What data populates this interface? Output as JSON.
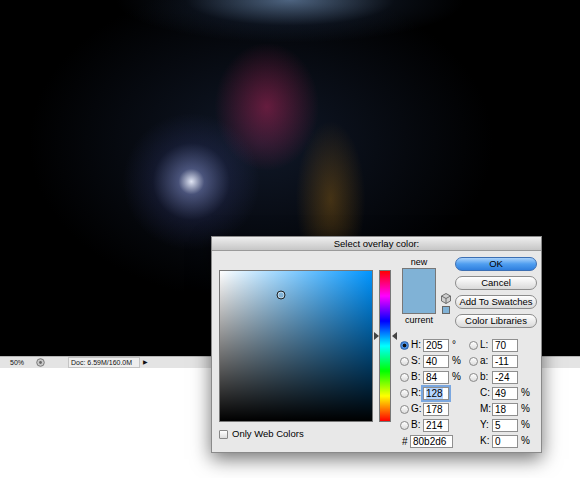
{
  "document": {
    "zoom": "50%",
    "info": "Doc: 6.59M/160.0M",
    "menu_arrow": "▶"
  },
  "dialog": {
    "title": "Select overlay color:",
    "color_field": {
      "hue_color": "#0095ff",
      "x_level": 0.4,
      "y_level": 0.84
    },
    "hue_slider": {
      "level": 0.57
    },
    "swatch": {
      "new_label": "new",
      "current_label": "current",
      "new_color": "#80b2d6",
      "current_color": "#80b2d6"
    },
    "buttons": [
      {
        "label": "OK",
        "default": true
      },
      {
        "label": "Cancel",
        "default": false
      },
      {
        "label": "Add To Swatches",
        "default": false
      },
      {
        "label": "Color Libraries",
        "default": false
      }
    ],
    "fields_left": [
      {
        "label": "H:",
        "value": "205",
        "unit": "°",
        "selected": true,
        "focused": false
      },
      {
        "label": "S:",
        "value": "40",
        "unit": "%",
        "selected": false,
        "focused": false
      },
      {
        "label": "B:",
        "value": "84",
        "unit": "%",
        "selected": false,
        "focused": false
      },
      {
        "label": "R:",
        "value": "128",
        "selected": false,
        "focused": true
      },
      {
        "label": "G:",
        "value": "178",
        "selected": false,
        "focused": false
      },
      {
        "label": "B:",
        "value": "214",
        "selected": false,
        "focused": false
      }
    ],
    "fields_lab": [
      {
        "label": "L:",
        "value": "70",
        "selected": false,
        "focused": false
      },
      {
        "label": "a:",
        "value": "-11",
        "selected": false,
        "focused": false
      },
      {
        "label": "b:",
        "value": "-24",
        "selected": false,
        "focused": false
      }
    ],
    "fields_cmyk": [
      {
        "label": "C:",
        "value": "49",
        "unit": "%",
        "focused": false
      },
      {
        "label": "M:",
        "value": "18",
        "unit": "%",
        "focused": false
      },
      {
        "label": "Y:",
        "value": "5",
        "unit": "%",
        "focused": false
      },
      {
        "label": "K:",
        "value": "0",
        "unit": "%",
        "focused": false
      }
    ],
    "hex": {
      "label": "#",
      "value": "80b2d6",
      "focused": false
    },
    "web_colors": {
      "label": "Only Web Colors",
      "checked": false
    }
  }
}
